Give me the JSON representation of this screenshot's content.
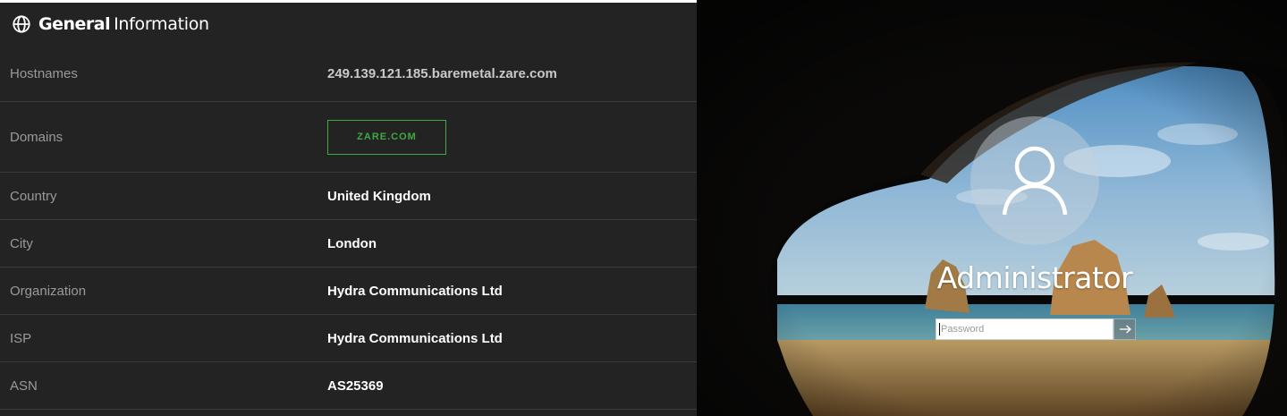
{
  "header": {
    "title_bold": "General",
    "title_light": "Information",
    "icon": "globe-icon"
  },
  "rows": [
    {
      "label": "Hostnames",
      "value": "249.139.121.185.baremetal.zare.com"
    },
    {
      "label": "Domains",
      "value": "ZARE.COM"
    },
    {
      "label": "Country",
      "value": "United Kingdom"
    },
    {
      "label": "City",
      "value": "London"
    },
    {
      "label": "Organization",
      "value": "Hydra Communications Ltd"
    },
    {
      "label": "ISP",
      "value": "Hydra Communications Ltd"
    },
    {
      "label": "ASN",
      "value": "AS25369"
    }
  ],
  "login": {
    "username": "Administrator",
    "password_placeholder": "Password",
    "user_icon": "user-icon",
    "submit_icon": "arrow-right-icon"
  },
  "colors": {
    "panel_bg": "#232323",
    "domain_tag": "#3ea844",
    "label": "#9a9a9a",
    "value": "#ffffff"
  }
}
